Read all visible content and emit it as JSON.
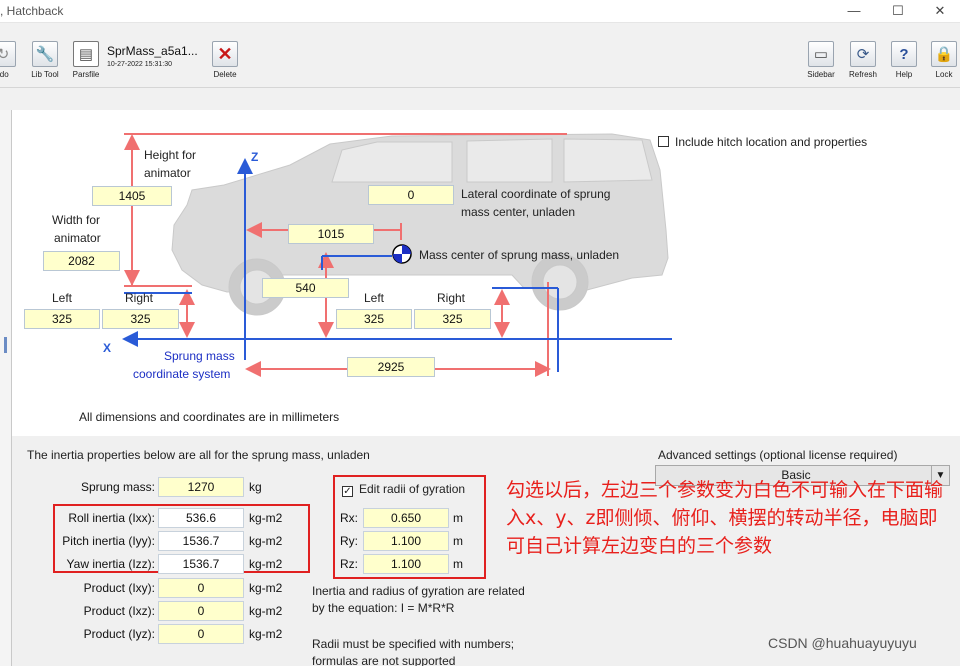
{
  "window": {
    "title": ", Hatchback",
    "min_glyph": "—",
    "max_glyph": "☐",
    "close_glyph": "✕"
  },
  "toolbar": {
    "redo_label": "edo",
    "libtool_label": "Lib Tool",
    "parsfile_label": "Parsfile",
    "parsfile_name": "SprMass_a5a1...",
    "parsfile_date": "10-27-2022 15:31:30",
    "delete_label": "Delete",
    "sidebar_label": "Sidebar",
    "refresh_label": "Refresh",
    "help_label": "Help",
    "lock_label": "Lock",
    "icons": {
      "redo": "redo-icon",
      "libtool": "wrench-icon",
      "parsfile": "document-icon",
      "delete": "red-x-icon",
      "sidebar": "sidebar-icon",
      "refresh": "refresh-icon",
      "help": "question-icon",
      "lock": "lock-icon"
    }
  },
  "diagram": {
    "hitch_checkbox_label": "Include hitch location and properties",
    "height_label_1": "Height for",
    "height_label_2": "animator",
    "height_value": "1405",
    "width_label_1": "Width for",
    "width_label_2": "animator",
    "width_value": "2082",
    "lateral_value": "0",
    "lateral_label_1": "Lateral coordinate of sprung",
    "lateral_label_2": "mass center, unladen",
    "cg_x_value": "1015",
    "mass_center_label": "Mass center of sprung mass, unladen",
    "cg_z_value": "540",
    "front_left_label": "Left",
    "front_right_label": "Right",
    "front_left_value": "325",
    "front_right_value": "325",
    "rear_left_label": "Left",
    "rear_right_label": "Right",
    "rear_left_value": "325",
    "rear_right_value": "325",
    "wheelbase_value": "2925",
    "axis_z": "Z",
    "axis_x": "X",
    "coord_label_1": "Sprung mass",
    "coord_label_2": "coordinate system",
    "units_note": "All dimensions and coordinates are in millimeters"
  },
  "inertia": {
    "heading": "The inertia properties below are all for the sprung mass, unladen",
    "mass_label": "Sprung mass:",
    "mass_value": "1270",
    "mass_unit": "kg",
    "ixx_label": "Roll inertia (Ixx):",
    "ixx_value": "536.6",
    "ixx_unit": "kg-m2",
    "iyy_label": "Pitch inertia (Iyy):",
    "iyy_value": "1536.7",
    "iyy_unit": "kg-m2",
    "izz_label": "Yaw inertia (Izz):",
    "izz_value": "1536.7",
    "izz_unit": "kg-m2",
    "ixy_label": "Product (Ixy):",
    "ixy_value": "0",
    "ixy_unit": "kg-m2",
    "ixz_label": "Product (Ixz):",
    "ixz_value": "0",
    "ixz_unit": "kg-m2",
    "iyz_label": "Product (Iyz):",
    "iyz_value": "0",
    "iyz_unit": "kg-m2"
  },
  "gyration": {
    "checkbox_label": "Edit radii of gyration",
    "checked": true,
    "rx_label": "Rx:",
    "rx_value": "0.650",
    "rx_unit": "m",
    "ry_label": "Ry:",
    "ry_value": "1.100",
    "ry_unit": "m",
    "rz_label": "Rz:",
    "rz_value": "1.100",
    "rz_unit": "m",
    "note_1": "Inertia and radius of gyration are related",
    "note_2": "by the equation: I = M*R*R",
    "note_3": "Radii must be specified with numbers;",
    "note_4": "formulas are not supported"
  },
  "advanced": {
    "label": "Advanced settings (optional license required)",
    "selected": "Basic"
  },
  "annotation": {
    "text": "勾选以后，左边三个参数变为白色不可输入在下面输入x、y、z即侧倾、俯仰、横摆的转动半径，电脑即可自己计算左边变白的三个参数"
  },
  "watermark": "CSDN @huahuayuyuyu",
  "colors": {
    "field_yellow": "#ffffcc",
    "annotation_red": "#e8201c",
    "arrow_red": "#f07070",
    "axis_blue": "#2a5bd7"
  }
}
